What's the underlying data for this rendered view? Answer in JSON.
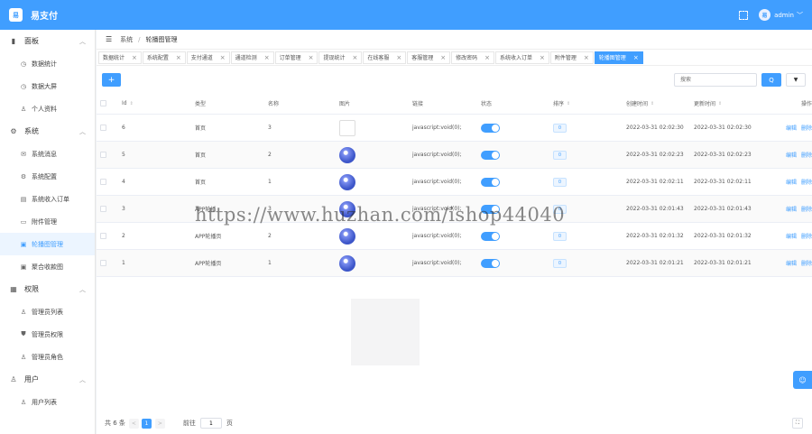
{
  "app": {
    "brand_logo": "易",
    "brand_name": "易支付",
    "user": "admin",
    "accent": "#409eff"
  },
  "sidebar": {
    "groups": [
      {
        "label": "面板",
        "icon": "chart-icon",
        "arrow": "︿",
        "items": [
          {
            "label": "数据统计",
            "icon": "clock-icon"
          },
          {
            "label": "数据大屏",
            "icon": "clock-icon"
          },
          {
            "label": "个人资料",
            "icon": "user-icon"
          }
        ]
      },
      {
        "label": "系统",
        "icon": "gear-icon",
        "arrow": "︿",
        "items": [
          {
            "label": "系统消息",
            "icon": "mail-icon"
          },
          {
            "label": "系统配置",
            "icon": "gear-icon"
          },
          {
            "label": "系统收入订单",
            "icon": "doc-icon"
          },
          {
            "label": "附件管理",
            "icon": "file-icon"
          },
          {
            "label": "轮播图管理",
            "icon": "image-icon"
          },
          {
            "label": "聚合收款图",
            "icon": "image-icon"
          }
        ]
      },
      {
        "label": "权限",
        "icon": "grid-icon",
        "arrow": "︿",
        "items": [
          {
            "label": "管理员列表",
            "icon": "user-icon"
          },
          {
            "label": "管理员权限",
            "icon": "shield-icon"
          },
          {
            "label": "管理员角色",
            "icon": "user-icon"
          }
        ]
      },
      {
        "label": "用户",
        "icon": "user-icon",
        "arrow": "︿",
        "items": [
          {
            "label": "用户列表",
            "icon": "user-icon"
          }
        ]
      }
    ]
  },
  "breadcrumb": {
    "items": [
      "系统",
      "轮播图管理"
    ],
    "sep": "/"
  },
  "tabs": [
    "数据统计",
    "系统配置",
    "支付通道",
    "通道检测",
    "订单管理",
    "提现统计",
    "在线客服",
    "客服管理",
    "修改密码",
    "系统收入订单",
    "附件管理",
    "轮播图管理"
  ],
  "toolbar": {
    "add_label": "+",
    "search_placeholder": "搜索",
    "search_label": "Q",
    "filter_label": "▼"
  },
  "table": {
    "headers": {
      "id": "Id",
      "type": "类型",
      "name": "名称",
      "image": "图片",
      "link": "链接",
      "status": "状态",
      "sort": "排序",
      "created": "创建时间",
      "updated": "更新时间",
      "ops": "操作"
    },
    "rows": [
      {
        "id": "6",
        "type": "首页",
        "name": "3",
        "thumb": "doc",
        "link": "javascript:void(0);",
        "status": true,
        "sort": "0",
        "created": "2022-03-31 02:02:30",
        "updated": "2022-03-31 02:02:30"
      },
      {
        "id": "5",
        "type": "首页",
        "name": "2",
        "thumb": "img",
        "link": "javascript:void(0);",
        "status": true,
        "sort": "0",
        "created": "2022-03-31 02:02:23",
        "updated": "2022-03-31 02:02:23"
      },
      {
        "id": "4",
        "type": "首页",
        "name": "1",
        "thumb": "img",
        "link": "javascript:void(0);",
        "status": true,
        "sort": "0",
        "created": "2022-03-31 02:02:11",
        "updated": "2022-03-31 02:02:11"
      },
      {
        "id": "3",
        "type": "APP轮播",
        "name": "3",
        "thumb": "img",
        "link": "javascript:void(0);",
        "status": true,
        "sort": "0",
        "created": "2022-03-31 02:01:43",
        "updated": "2022-03-31 02:01:43"
      },
      {
        "id": "2",
        "type": "APP轮播页",
        "name": "2",
        "thumb": "img",
        "link": "javascript:void(0);",
        "status": true,
        "sort": "0",
        "created": "2022-03-31 02:01:32",
        "updated": "2022-03-31 02:01:32"
      },
      {
        "id": "1",
        "type": "APP轮播页",
        "name": "1",
        "thumb": "img",
        "link": "javascript:void(0);",
        "status": true,
        "sort": "0",
        "created": "2022-03-31 02:01:21",
        "updated": "2022-03-31 02:01:21"
      }
    ],
    "op_edit": "编辑",
    "op_delete": "删除"
  },
  "pager": {
    "total": "共 6 条",
    "prev": "<",
    "current": "1",
    "next": ">",
    "goto_label": "前往",
    "goto_value": "1",
    "page_unit": "页"
  },
  "watermark": "https://www.huzhan.com/ishop44040"
}
